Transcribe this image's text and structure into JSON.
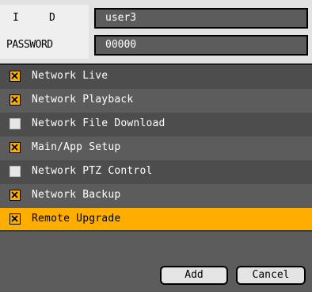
{
  "fields": {
    "id_label": [
      "I",
      "D"
    ],
    "id_value": "user3",
    "password_label": "PASSWORD",
    "password_value": "00000"
  },
  "permissions": [
    {
      "label": "Network Live",
      "checked": true
    },
    {
      "label": "Network Playback",
      "checked": true
    },
    {
      "label": "Network File Download",
      "checked": false
    },
    {
      "label": "Main/App Setup",
      "checked": true
    },
    {
      "label": "Network PTZ Control",
      "checked": false
    },
    {
      "label": "Network Backup",
      "checked": true
    },
    {
      "label": "Remote Upgrade",
      "checked": true,
      "highlighted": true
    }
  ],
  "buttons": {
    "add": "Add",
    "cancel": "Cancel"
  },
  "colors": {
    "accent": "#ffae00",
    "row_dark": "#4d4d4d",
    "row_light": "#5c5c5c",
    "header_bg": "#e2e2e2"
  }
}
